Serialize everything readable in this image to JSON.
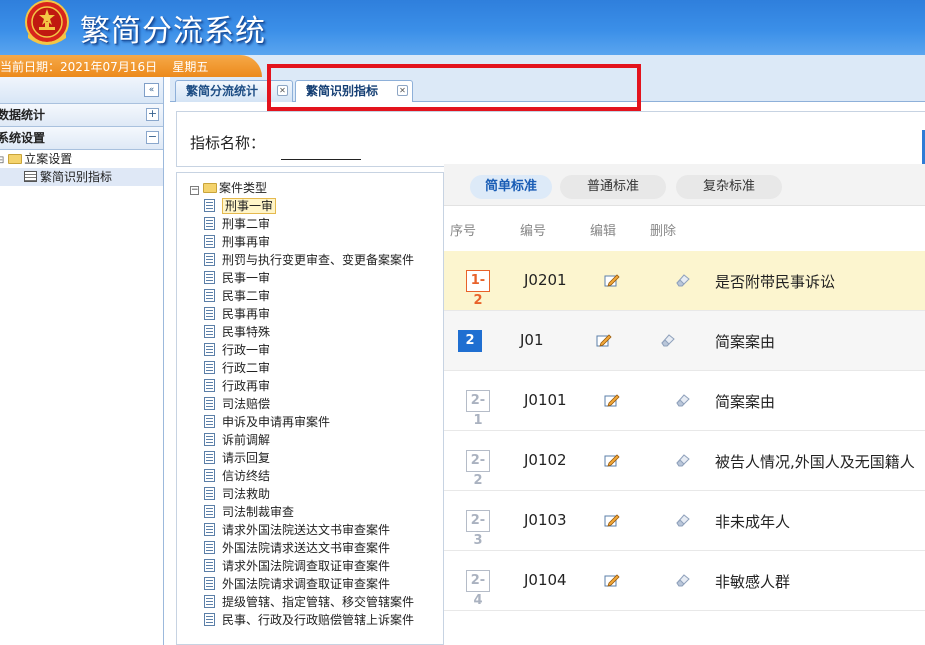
{
  "header": {
    "title": "繁简分流系统"
  },
  "datebar": {
    "date_text": "当前日期：2021年07月16日",
    "weekday": "星期五"
  },
  "sidebar": {
    "collapse_icon": "double-chevron-left-icon",
    "sections": [
      {
        "label": "数据统计",
        "toggle": "+"
      },
      {
        "label": "系统设置",
        "toggle": "−"
      }
    ],
    "tree": {
      "folder_label": "立案设置",
      "item_label": "繁简识别指标"
    }
  },
  "tabs": [
    {
      "label": "繁简分流统计"
    },
    {
      "label": "繁简识别指标"
    }
  ],
  "filter": {
    "label": "指标名称：",
    "value": ""
  },
  "case_tree": {
    "root": "案件类型",
    "items": [
      "刑事一审",
      "刑事二审",
      "刑事再审",
      "刑罚与执行变更审查、变更备案案件",
      "民事一审",
      "民事二审",
      "民事再审",
      "民事特殊",
      "行政一审",
      "行政二审",
      "行政再审",
      "司法赔偿",
      "申诉及申请再审案件",
      "诉前调解",
      "请示回复",
      "信访终结",
      "司法救助",
      "司法制裁审查",
      "请求外国法院送达文书审查案件",
      "外国法院请求送达文书审查案件",
      "请求外国法院调查取证审查案件",
      "外国法院请求调查取证审查案件",
      "提级管辖、指定管辖、移交管辖案件",
      "民事、行政及行政赔偿管辖上诉案件"
    ]
  },
  "standards": {
    "tabs": [
      "简单标准",
      "普通标准",
      "复杂标准"
    ]
  },
  "list": {
    "headers": {
      "seq": "序号",
      "code": "编号",
      "edit": "编辑",
      "delete": "删除"
    },
    "rows": [
      {
        "seq": "1-2",
        "code": "J0201",
        "desc": "是否附带民事诉讼"
      },
      {
        "seq": "2",
        "code": "J01",
        "desc": "简案案由"
      },
      {
        "seq": "2-1",
        "code": "J0101",
        "desc": "简案案由"
      },
      {
        "seq": "2-2",
        "code": "J0102",
        "desc": "被告人情况,外国人及无国籍人"
      },
      {
        "seq": "2-3",
        "code": "J0103",
        "desc": "非未成年人"
      },
      {
        "seq": "2-4",
        "code": "J0104",
        "desc": "非敏感人群"
      }
    ]
  },
  "colors": {
    "header_blue": "#3b8fe8",
    "date_orange": "#ec8a1c",
    "highlight_red": "#e3131d",
    "badge_blue": "#1f6fd1"
  }
}
